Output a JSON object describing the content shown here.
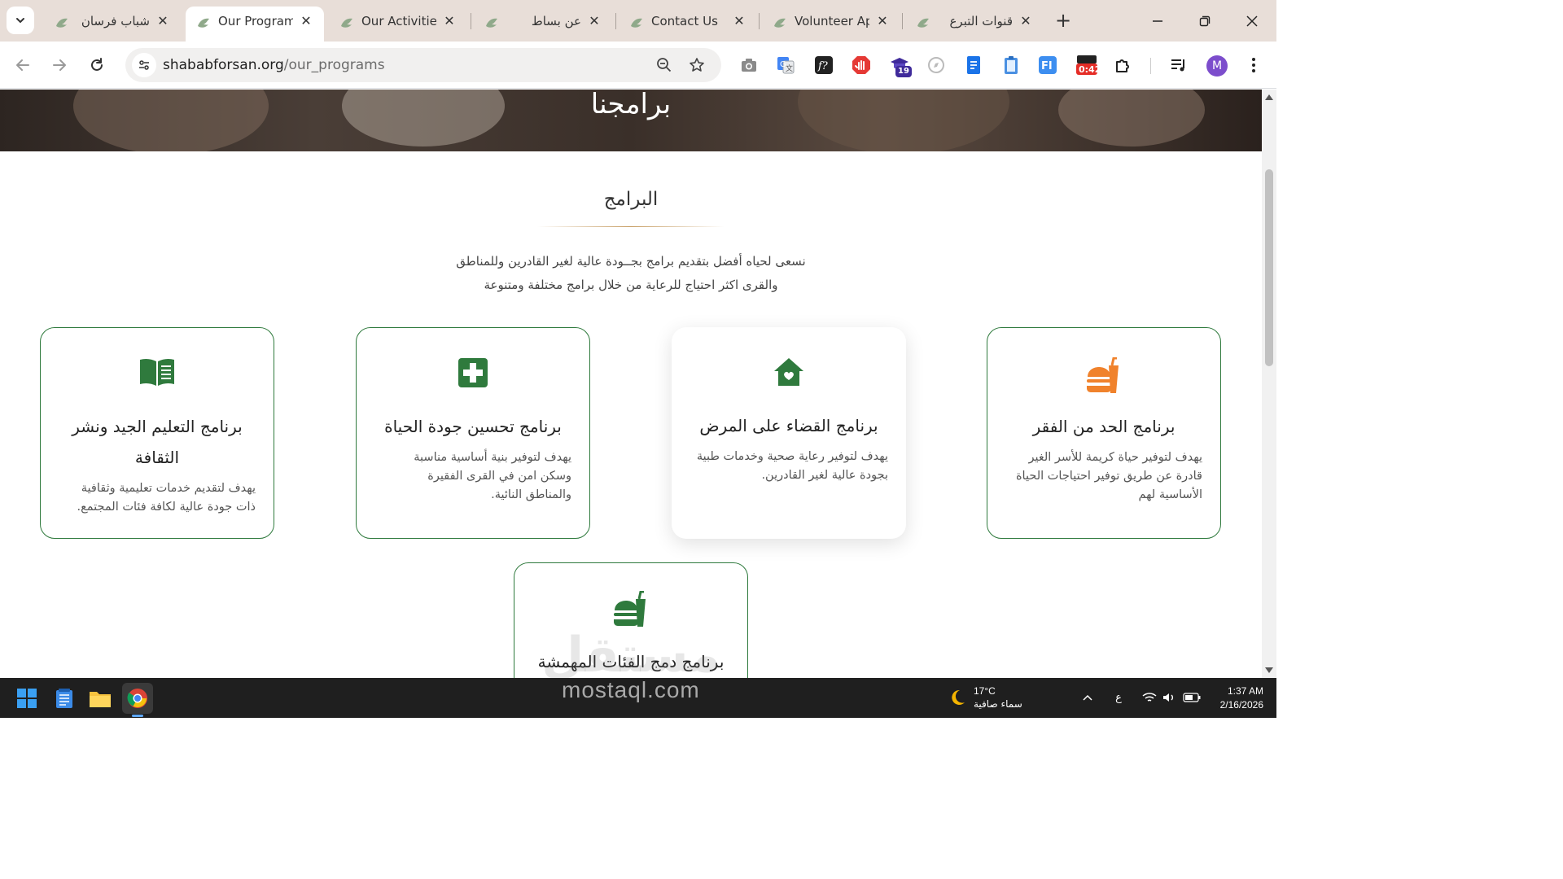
{
  "browser": {
    "tabs": [
      {
        "label": "شباب فرسان",
        "rtl": true,
        "active": false
      },
      {
        "label": "Our Programs",
        "rtl": false,
        "active": true
      },
      {
        "label": "Our Activities",
        "rtl": false,
        "active": false
      },
      {
        "label": "عن بساط",
        "rtl": true,
        "active": false
      },
      {
        "label": "Contact Us",
        "rtl": false,
        "active": false
      },
      {
        "label": "Volunteer Application",
        "rtl": false,
        "active": false
      },
      {
        "label": "قنوات التبرع",
        "rtl": true,
        "active": false
      }
    ],
    "url_domain": "shababforsan.org",
    "url_path": "/our_programs",
    "extensions": {
      "badge_count": "19",
      "timer_badge": "0:42"
    },
    "profile_initial": "M"
  },
  "page": {
    "hero_title": "برامجنا",
    "section_title": "البرامج",
    "section_description_line1": "نسعى لحياه أفضل بتقديم برامج بجــودة عالية لغير القادرين وللمناطق",
    "section_description_line2": "والقرى اكثر احتياج للرعاية من خلال برامج مختلفة ومتنوعة",
    "programs": [
      {
        "title": "برنامج الحد من الفقر",
        "description": "يهدف لتوفير حياة كريمة للأسر الغير قادرة عن طريق توفير احتياجات الحياة الأساسية لهم",
        "icon": "burger-drink-icon",
        "icon_color": "#f0822c"
      },
      {
        "title": "برنامج القضاء على المرض",
        "description": "يهدف لتوفير رعاية صحية وخدمات طبية بجودة عالية لغير القادرين.",
        "icon": "home-heart-icon",
        "icon_color": "#2f7a3d"
      },
      {
        "title": "برنامج تحسين جودة الحياة",
        "description": "يهدف لتوفير بنية أساسية مناسبة وسكن امن في القرى الفقيرة والمناطق النائية.",
        "icon": "medical-cross-icon",
        "icon_color": "#2f7a3d"
      },
      {
        "title": "برنامج التعليم الجيد ونشر الثقافة",
        "description": "يهدف لتقديم خدمات تعليمية وثقافية ذات جودة عالية لكافة فئات المجتمع.",
        "icon": "book-icon",
        "icon_color": "#2f7a3d"
      },
      {
        "title": "برنامج دمج الفئات المهمشة",
        "description": "",
        "icon": "burger-drink-icon",
        "icon_color": "#2f7a3d"
      }
    ],
    "watermark_ar": "مستقل",
    "watermark_en": "mostaql.com"
  },
  "taskbar": {
    "weather_temp": "17°C",
    "weather_desc": "سماء صافية",
    "lang": "ع",
    "time": "1:37 AM",
    "date": "2/16/2026"
  },
  "colors": {
    "brand_green": "#2f7a3d",
    "accent_orange": "#f0822c",
    "divider_gold": "#c69c61"
  }
}
